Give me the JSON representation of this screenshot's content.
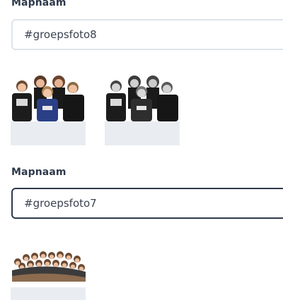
{
  "folders": [
    {
      "label": "Mapnaam",
      "value": "#groepsfoto8",
      "photos": [
        {
          "alt": "groepsfoto color"
        },
        {
          "alt": "groepsfoto black and white"
        }
      ]
    },
    {
      "label": "Mapnaam",
      "value": "#groepsfoto7",
      "photos": [
        {
          "alt": "large group photo"
        }
      ]
    }
  ],
  "colors": {
    "label": "#2f3a4b",
    "field_border": "#dfe3ea",
    "field_border_active": "#2f3a4b",
    "thumb_bg": "#e9edf2"
  }
}
